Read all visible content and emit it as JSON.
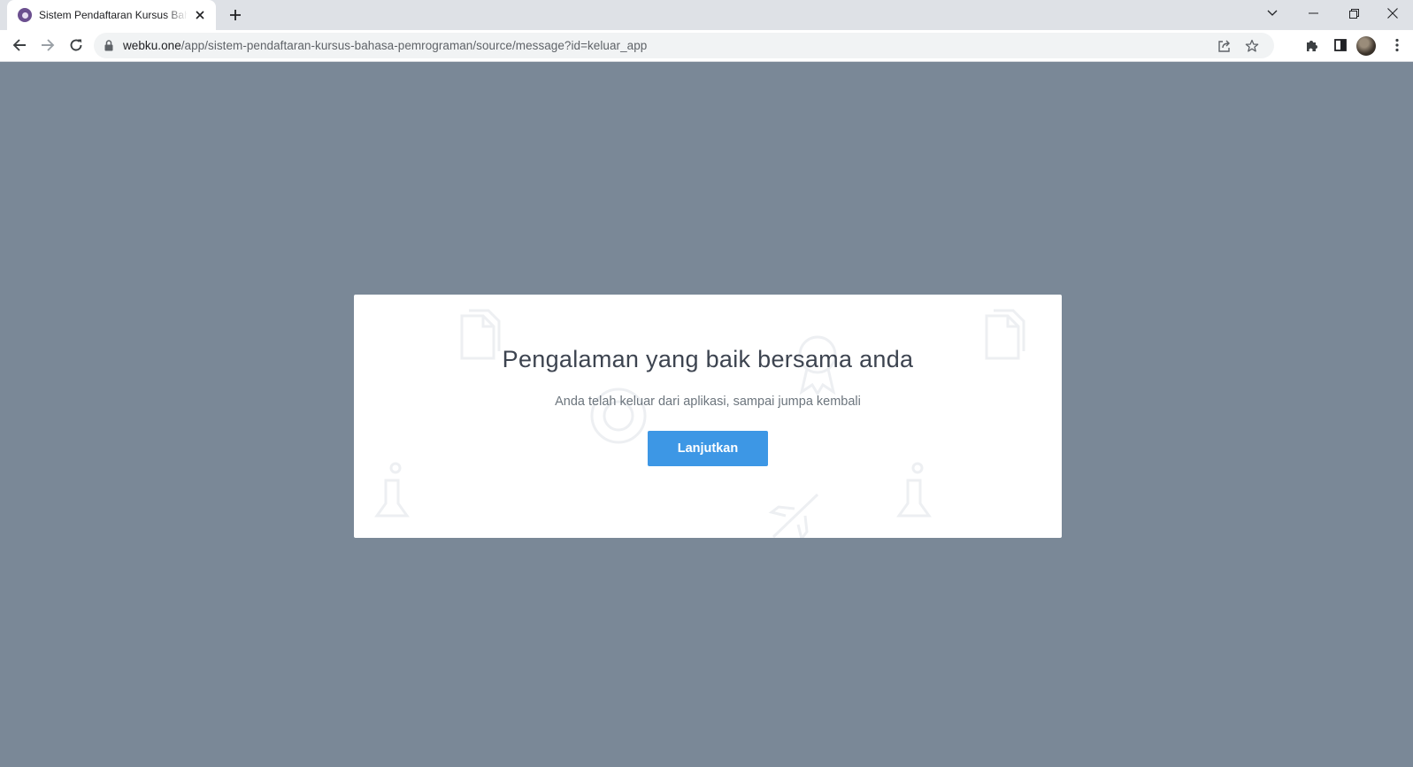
{
  "browser": {
    "tab": {
      "title": "Sistem Pendaftaran Kursus Bahasa Pemrograman",
      "favicon": "app-logo-icon",
      "close_icon": "close-icon"
    },
    "new_tab_icon": "plus-icon",
    "window_controls": [
      "chevron-down-icon",
      "minimize-icon",
      "restore-icon",
      "close-icon"
    ],
    "toolbar": {
      "back_icon": "arrow-left-icon",
      "forward_icon": "arrow-right-icon",
      "reload_icon": "reload-icon",
      "lock_icon": "lock-icon",
      "url_host": "webku.one",
      "url_path": "/app/sistem-pendaftaran-kursus-bahasa-pemrograman/source/message?id=keluar_app",
      "share_icon": "share-icon",
      "bookmark_icon": "star-icon",
      "extensions_icon": "puzzle-icon",
      "side_panel_icon": "side-panel-icon",
      "profile_icon": "avatar",
      "menu_icon": "kebab-menu-icon"
    }
  },
  "page": {
    "background_color": "#7a8897",
    "card": {
      "title": "Pengalaman yang baik bersama anda",
      "subtitle": "Anda telah keluar dari aplikasi, sampai jumpa kembali",
      "button_label": "Lanjutkan",
      "button_color": "#3d97e5",
      "background_icons": [
        "document-icon",
        "award-ribbon-icon",
        "document-icon",
        "target-icon",
        "chess-piece-icon",
        "airplane-icon",
        "chess-piece-icon"
      ]
    }
  }
}
